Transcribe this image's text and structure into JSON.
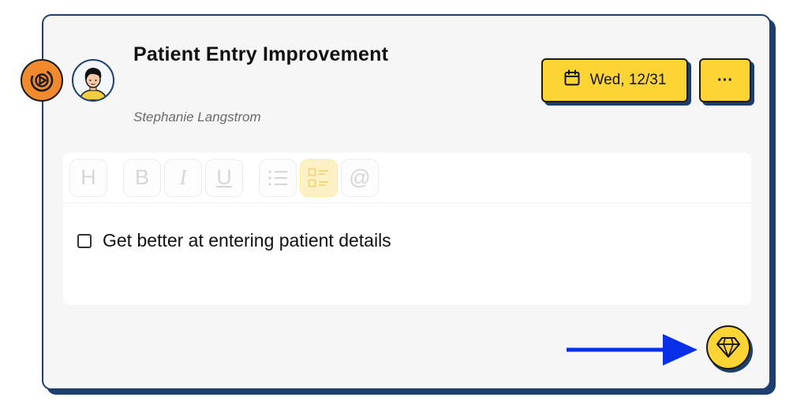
{
  "card": {
    "title": "Patient Entry Improvement",
    "owner": "Stephanie Langstrom",
    "due_date_label": "Wed, 12/31",
    "more_label": "···"
  },
  "icons": {
    "goal": "target-play-icon",
    "avatar": "user-avatar",
    "calendar": "calendar-icon",
    "gem": "diamond-icon",
    "arrow": "arrow-right-icon"
  },
  "toolbar": {
    "buttons": [
      {
        "label": "H",
        "name": "heading"
      },
      {
        "label": "B",
        "name": "bold"
      },
      {
        "label": "I",
        "name": "italic"
      },
      {
        "label": "U",
        "name": "underline"
      },
      {
        "label": "",
        "name": "bullet-list"
      },
      {
        "label": "",
        "name": "checklist",
        "active": true
      },
      {
        "label": "@",
        "name": "mention"
      }
    ]
  },
  "tasks": [
    {
      "label": "Get better at entering patient details",
      "checked": false
    }
  ],
  "colors": {
    "accent_yellow": "#fcd535",
    "border_navy": "#1c3f6e",
    "goal_orange": "#f08a2c",
    "arrow_blue": "#0a2fe8"
  }
}
